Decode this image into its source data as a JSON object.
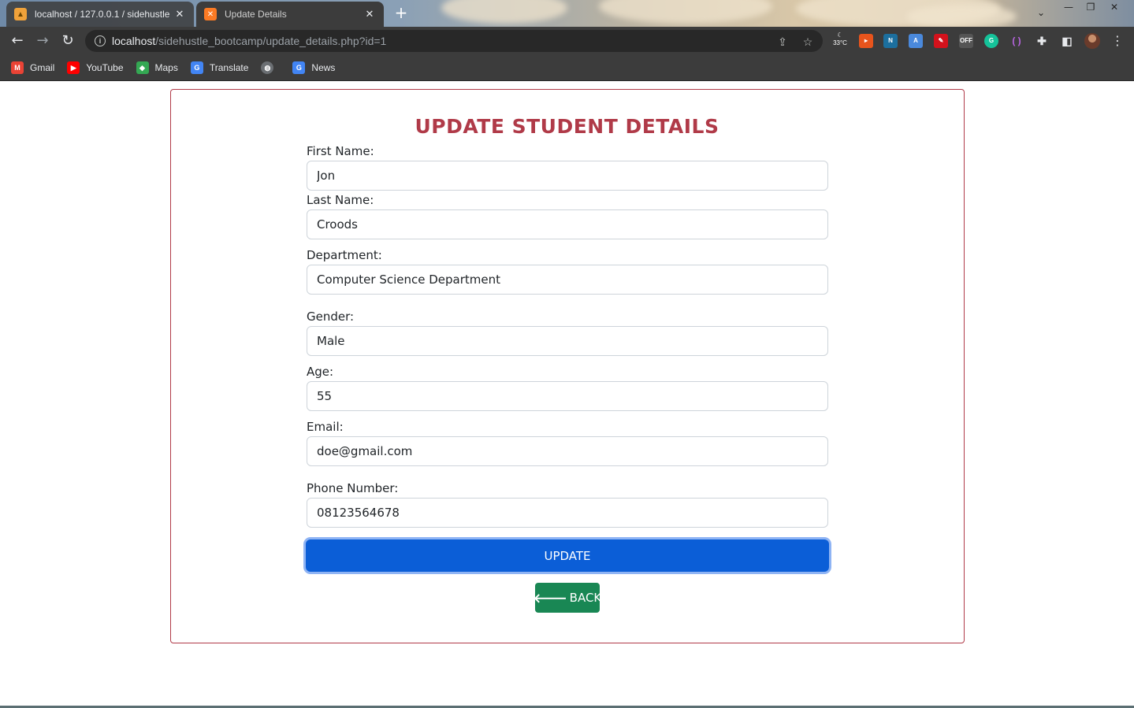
{
  "browser": {
    "tabs": [
      {
        "title": "localhost / 127.0.0.1 / sidehustle",
        "icon": "phpmyadmin-icon"
      },
      {
        "title": "Update Details",
        "icon": "xampp-icon"
      }
    ],
    "new_tab": "+",
    "close_glyph": "✕",
    "url_host": "localhost",
    "url_path": "/sidehustle_bootcamp/update_details.php?id=1",
    "weather": "33°C",
    "bookmarks": [
      {
        "label": "Gmail",
        "icon": "gmail-icon",
        "color": "#ea4335"
      },
      {
        "label": "YouTube",
        "icon": "youtube-icon",
        "color": "#ff0000"
      },
      {
        "label": "Maps",
        "icon": "maps-icon",
        "color": "#34a853"
      },
      {
        "label": "Translate",
        "icon": "translate-icon",
        "color": "#4285f4"
      },
      {
        "label": "",
        "icon": "globe-icon",
        "color": "#9aa0a6"
      },
      {
        "label": "News",
        "icon": "news-icon",
        "color": "#4285f4"
      }
    ]
  },
  "form": {
    "title": "UPDATE STUDENT DETAILS",
    "first_name": {
      "label": "First Name:",
      "value": "Jon"
    },
    "last_name": {
      "label": "Last Name:",
      "value": "Croods"
    },
    "department": {
      "label": "Department:",
      "value": "Computer Science Department"
    },
    "gender": {
      "label": "Gender:",
      "value": "Male"
    },
    "age": {
      "label": "Age:",
      "value": "55"
    },
    "email": {
      "label": "Email:",
      "value": "doe@gmail.com"
    },
    "phone": {
      "label": "Phone Number:",
      "value": "08123564678"
    },
    "update_label": "UPDATE",
    "back_label": "BACK"
  },
  "colors": {
    "accent": "#b03a48",
    "primary_button": "#0b5ed7",
    "success_button": "#198754"
  }
}
